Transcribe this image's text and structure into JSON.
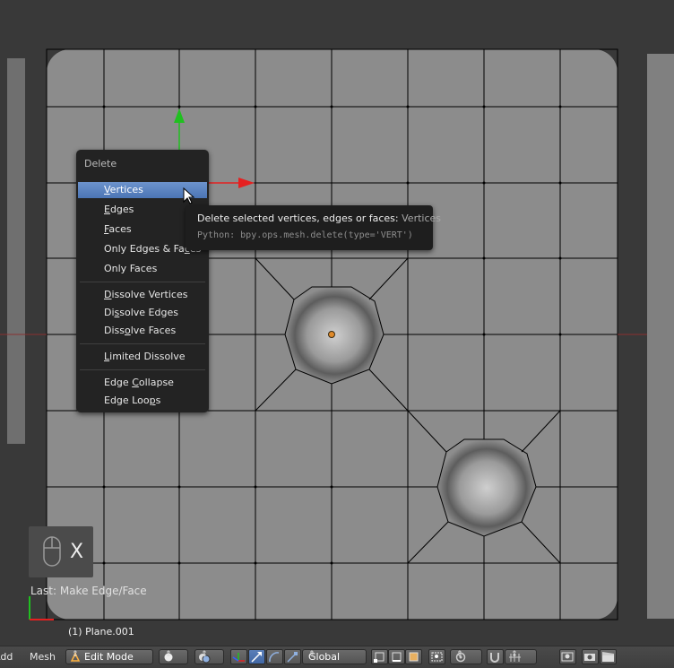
{
  "menu": {
    "title": "Delete",
    "items": [
      {
        "pre": "",
        "u": "V",
        "post": "ertices"
      },
      {
        "pre": "",
        "u": "E",
        "post": "dges"
      },
      {
        "pre": "",
        "u": "F",
        "post": "aces"
      },
      {
        "pre": "Only Edges & Fa",
        "u": "c",
        "post": "es"
      },
      {
        "pre": "Only Faces",
        "u": "",
        "post": ""
      },
      {
        "pre": "",
        "u": "D",
        "post": "issolve Vertices"
      },
      {
        "pre": "Di",
        "u": "s",
        "post": "solve Edges"
      },
      {
        "pre": "Diss",
        "u": "o",
        "post": "lve Faces"
      },
      {
        "pre": "",
        "u": "L",
        "post": "imited Dissolve"
      },
      {
        "pre": "Edge ",
        "u": "C",
        "post": "ollapse"
      },
      {
        "pre": "Edge Loo",
        "u": "p",
        "post": "s"
      }
    ]
  },
  "tooltip": {
    "description": "Delete selected vertices, edges or faces:",
    "value": "Vertices",
    "python": "Python: bpy.ops.mesh.delete(type='VERT')"
  },
  "overlay": {
    "key": "X"
  },
  "last_operator": "Last: Make Edge/Face",
  "object_name": "(1) Plane.001",
  "header": {
    "add": "Add",
    "mesh": "Mesh",
    "mode": "Edit Mode",
    "orientation": "Global"
  },
  "colors": {
    "accent": "#5680c2",
    "x_axis": "#e52020",
    "y_axis": "#20c020"
  }
}
